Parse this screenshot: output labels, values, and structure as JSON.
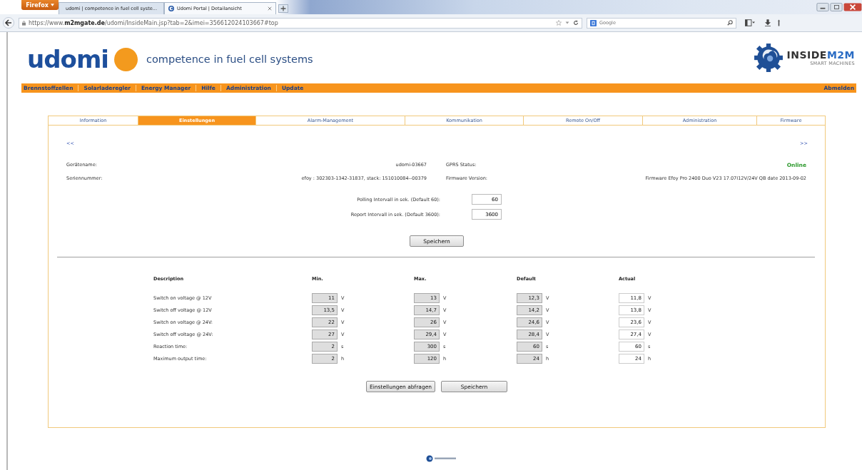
{
  "browser": {
    "menu_button": "Firefox",
    "tabs": [
      {
        "title": "udomi | competence in fuel cell syste...",
        "selected": false
      },
      {
        "title": "Udomi Portal | Detailansicht",
        "selected": true
      }
    ],
    "url": "https://www.**m2mgate.de**/udomi/InsideMain.jsp?tab=2&imei=356612024103667#top",
    "search": {
      "placeholder": "Google"
    }
  },
  "header": {
    "brand": "udomi",
    "tagline": "competence in fuel cell systems",
    "partner": {
      "name_first": "INSIDE",
      "name_second": "M2M",
      "subtitle": "SMART MACHINES"
    }
  },
  "nav": {
    "items": [
      "Brennstoffzellen",
      "Solarladeregler",
      "Energy Manager",
      "Hilfe",
      "Administration",
      "Update"
    ],
    "logout": "Abmelden"
  },
  "tabs": [
    {
      "label": "Information",
      "selected": false
    },
    {
      "label": "Einstellungen",
      "selected": true
    },
    {
      "label": "Alarm-Management",
      "selected": false
    },
    {
      "label": "Kommunikation",
      "selected": false
    },
    {
      "label": "Remote On/Off",
      "selected": false
    },
    {
      "label": "Administration",
      "selected": false
    },
    {
      "label": "Firmware",
      "selected": false
    }
  ],
  "pager": {
    "previous": "<<",
    "next": ">>"
  },
  "info": [
    {
      "left": {
        "label": "Gerätename:",
        "value": "udomi-03667"
      },
      "right": {
        "label": "GPRS Status:",
        "value": "Online",
        "color": "#2e9a2e"
      }
    },
    {
      "left": {
        "label": "Seriennummer:",
        "value": "efoy : 302303-1342-31837, stack: 151010084--00379"
      },
      "right": {
        "label": "Firmware Version:",
        "value": "Firmware Efoy Pro 2400 Duo V23 17.07I12V/24V QB date 2013-09-02"
      }
    }
  ],
  "intervals": [
    {
      "label": "Polling Intervall in sek. (Default 60):",
      "value": "60"
    },
    {
      "label": "Report Intervall in sek. (Default 3600):",
      "value": "3600"
    }
  ],
  "intervals_save": "Speichern",
  "table": {
    "columns": [
      "Description",
      "Min.",
      "Max.",
      "Default",
      "Actual"
    ],
    "rows": [
      {
        "label": "Switch on voltage @ 12V",
        "cells": [
          {
            "value": "11",
            "unit": "V",
            "disabled": true
          },
          {
            "value": "13",
            "unit": "V",
            "disabled": true
          },
          {
            "value": "12,3",
            "unit": "V",
            "disabled": true
          },
          {
            "value": "11,8",
            "unit": "V",
            "disabled": false
          }
        ]
      },
      {
        "label": "Switch off voltage @ 12V",
        "cells": [
          {
            "value": "13,5",
            "unit": "V",
            "disabled": true
          },
          {
            "value": "14,7",
            "unit": "V",
            "disabled": true
          },
          {
            "value": "14,2",
            "unit": "V",
            "disabled": true
          },
          {
            "value": "13,8",
            "unit": "V",
            "disabled": false
          }
        ]
      },
      {
        "label": "Switch on voltage @ 24V:",
        "cells": [
          {
            "value": "22",
            "unit": "V",
            "disabled": true
          },
          {
            "value": "26",
            "unit": "V",
            "disabled": true
          },
          {
            "value": "24,6",
            "unit": "V",
            "disabled": true
          },
          {
            "value": "23,6",
            "unit": "V",
            "disabled": false
          }
        ]
      },
      {
        "label": "Switch off voltage @ 24V:",
        "cells": [
          {
            "value": "27",
            "unit": "V",
            "disabled": true
          },
          {
            "value": "29,4",
            "unit": "V",
            "disabled": true
          },
          {
            "value": "28,4",
            "unit": "V",
            "disabled": true
          },
          {
            "value": "27,4",
            "unit": "V",
            "disabled": false
          }
        ]
      },
      {
        "label": "Reaction time:",
        "cells": [
          {
            "value": "2",
            "unit": "s",
            "disabled": true
          },
          {
            "value": "300",
            "unit": "s",
            "disabled": true
          },
          {
            "value": "60",
            "unit": "s",
            "disabled": true
          },
          {
            "value": "60",
            "unit": "s",
            "disabled": false
          }
        ]
      },
      {
        "label": "Maximum output time:",
        "cells": [
          {
            "value": "2",
            "unit": "h",
            "disabled": true
          },
          {
            "value": "120",
            "unit": "h",
            "disabled": true
          },
          {
            "value": "24",
            "unit": "h",
            "disabled": true
          },
          {
            "value": "24",
            "unit": "h",
            "disabled": false
          }
        ]
      }
    ]
  },
  "buttons": [
    "Einstellungen abfragen",
    "Speichern"
  ]
}
